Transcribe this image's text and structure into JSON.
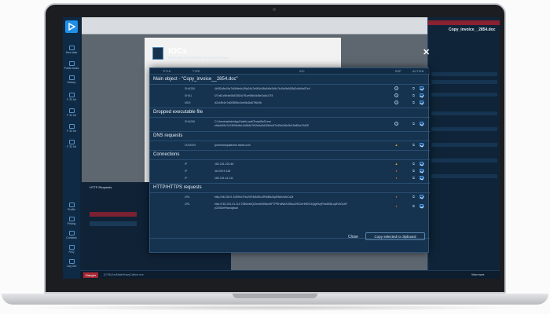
{
  "sidebar": {
    "items": [
      {
        "label": "New task"
      },
      {
        "label": "Public tasks"
      },
      {
        "label": "History"
      },
      {
        "label": "F 32 bit"
      },
      {
        "label": "F 32 bit"
      },
      {
        "label": "F 32 bit"
      },
      {
        "label": "F 32 bit"
      },
      {
        "label": "Profile"
      },
      {
        "label": "Pricing"
      },
      {
        "label": "Contacts"
      },
      {
        "label": "FAQ"
      },
      {
        "label": "Log Out"
      }
    ]
  },
  "background": {
    "task_title": "Copy_invoice__2854.doc",
    "http_tab": "HTTP Requests",
    "status_badge": "Danger",
    "bottom_text": "[1796] ArsMalaHeavyCallme.exe",
    "bottom_right": "View more"
  },
  "ioc": {
    "title": "IOCs",
    "subtitle": "Summary of indicators of compromises"
  },
  "modal": {
    "headers": {
      "title": "TITLE",
      "type": "TYPE",
      "ioc": "IOC",
      "rep": "REP",
      "action": "ACTION"
    },
    "sections": [
      {
        "title": "Main object - \"Copy_invoice__2854.doc\"",
        "rows": [
          {
            "type": "SHA256",
            "value": "4b3f2c8e19a7d0b5e6c1f9a24d7e0b3c58a1f6e2d9c7b40a3e5f18d2c6b9a07e4",
            "rep": "ok"
          },
          {
            "type": "SHA1",
            "value": "f27a61c9b4e08d3352a7f1ce96b0d48e2a5c17f3",
            "rep": "ok"
          },
          {
            "type": "MD5",
            "value": "d2c49b1e7a0f3856c1be94d2a07f6e3b",
            "rep": "ok"
          }
        ]
      },
      {
        "title": "Dropped executable file",
        "rows": [
          {
            "type": "SHA256",
            "value": "C:\\Users\\admin\\AppData\\Local\\Temp\\5a2f.exe",
            "value2": "e5a4d91b7c03f26e8a1d49b5c7f02e6a3d18b9c4f7e05a2d6c9b13e8f4a70d25",
            "rep": "ok"
          }
        ]
      },
      {
        "title": "DNS requests",
        "rows": [
          {
            "type": "DOMAIN",
            "value": "quebrantopalavres.fazeit.com",
            "rep": "warn"
          }
        ]
      },
      {
        "title": "Connections",
        "rows": [
          {
            "type": "IP",
            "value": "162.241.224.46",
            "rep": "warn"
          },
          {
            "type": "IP",
            "value": "46.249.9.118",
            "rep": "fire"
          },
          {
            "type": "IP",
            "value": "162.241.41.111",
            "rep": "fire"
          }
        ]
      },
      {
        "title": "HTTP/HTTPS requests",
        "rows": [
          {
            "type": "URL",
            "value": "http://46.249.9.118/fh/c7Hu2VEMA5GcJR0dBsJ4pE8s0z6IcCuDl",
            "rep": "fire"
          },
          {
            "type": "URL",
            "value": "http://162.241.41.111:7080/cfeQCbnnKrlBwlcHF7PRHdNdXOBlxuZ9DJcHHEtCkQgRivyRVa5S8Lxy8Vb0JzR",
            "value2": "p2u0UmRwoogtua/",
            "rep": "fire"
          }
        ]
      }
    ],
    "close_label": "Close",
    "copy_label": "Copy selected to clipboard"
  },
  "colors": {
    "accent": "#3d93e6",
    "warn": "#f2a21f",
    "danger": "#ef5a2b",
    "bg": "#15324f"
  }
}
